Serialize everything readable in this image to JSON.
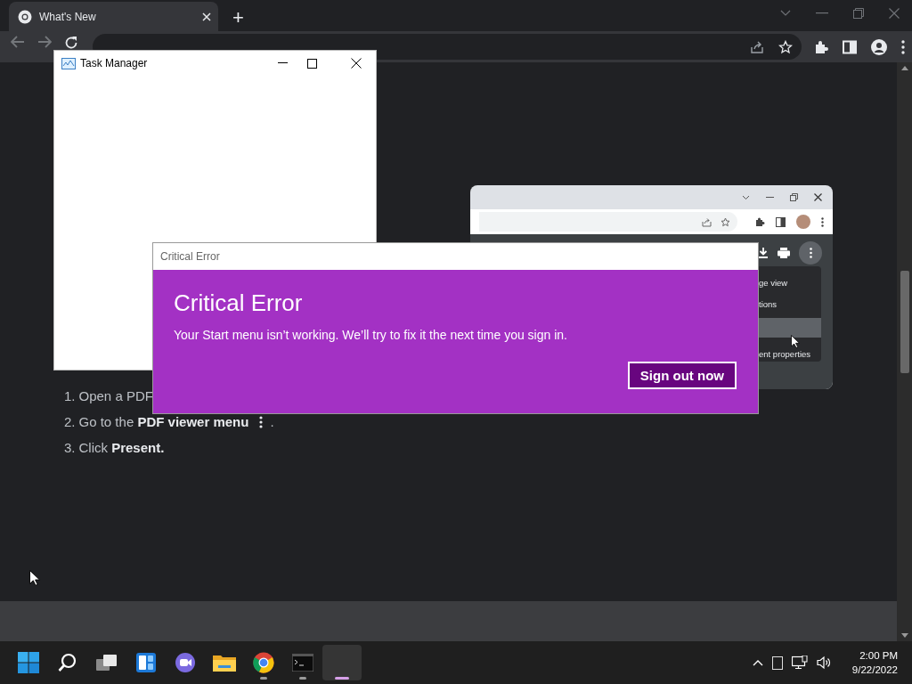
{
  "browser": {
    "tab": {
      "title": "What's New",
      "selected": true
    },
    "new_tab": "+"
  },
  "page": {
    "illustration": {
      "menu_items": [
        {
          "label": "ge view",
          "selected": false
        },
        {
          "label": "tions",
          "selected": false
        },
        {
          "selected": true
        },
        {
          "label": "ent properties",
          "selected": false
        }
      ]
    },
    "steps": [
      {
        "number": "1.",
        "text": "Open a PDF"
      },
      {
        "number": "2.",
        "text": "Go to the **PDF viewer menu**",
        "menu_icon": true,
        "suffix": "."
      },
      {
        "number": "3.",
        "text": "Click **Present.**"
      }
    ]
  },
  "task_manager": {
    "title": "Task Manager"
  },
  "dialog": {
    "window_title": "Critical Error",
    "heading": "Critical Error",
    "message": "Your Start menu isn’t working. We’ll try to fix it the next time you sign in.",
    "button": "Sign out now"
  },
  "taskbar": {
    "apps": [
      {
        "kind": "start",
        "running": false,
        "selected": false
      },
      {
        "kind": "search",
        "running": false,
        "selected": false
      },
      {
        "kind": "taskview",
        "running": false,
        "selected": false
      },
      {
        "kind": "widgets",
        "running": false,
        "selected": false
      },
      {
        "kind": "chat",
        "running": false,
        "selected": false
      },
      {
        "kind": "explorer",
        "running": false,
        "selected": false
      },
      {
        "kind": "chrome",
        "running": true,
        "selected": false
      },
      {
        "kind": "terminal",
        "running": true,
        "selected": false
      },
      {
        "kind": "blank",
        "running": true,
        "selected": true
      }
    ],
    "time": "2:00 PM",
    "date": "9/22/2022"
  }
}
